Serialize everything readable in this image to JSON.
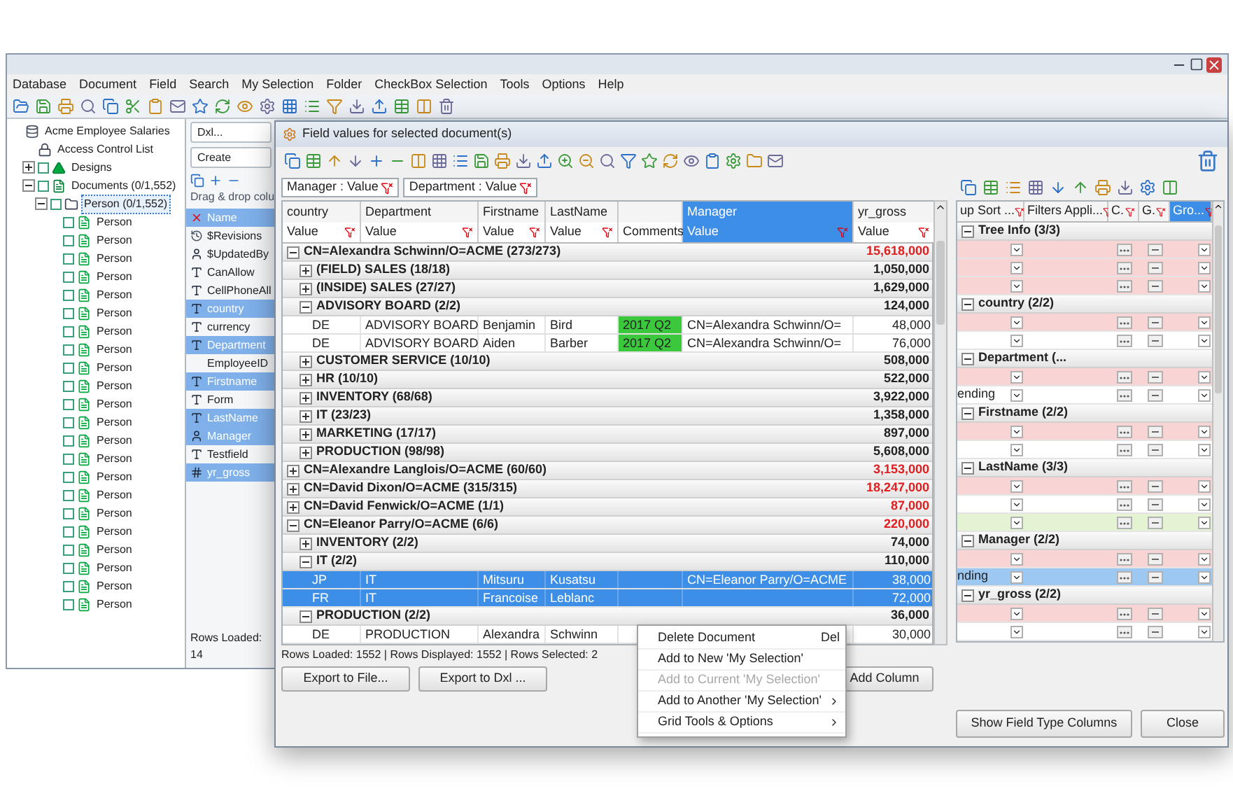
{
  "window": {
    "menu": [
      "Database",
      "Document",
      "Field",
      "Search",
      "My Selection",
      "Folder",
      "CheckBox Selection",
      "Tools",
      "Options",
      "Help"
    ]
  },
  "tree": [
    {
      "label": "Acme Employee Salaries",
      "kind": "database",
      "selected": false,
      "children": [
        {
          "label": "Access Control List",
          "kind": "acl",
          "selected": false
        },
        {
          "label": "Designs",
          "kind": "design",
          "expanded": false,
          "checked": false,
          "selected": false
        },
        {
          "label": "Documents (0/1,552)",
          "kind": "documents",
          "expanded": true,
          "checked": false,
          "selected": false,
          "children": [
            {
              "label": "Person (0/1,552)",
              "kind": "folder",
              "expanded": true,
              "checked": false,
              "selected": true,
              "children": [
                {
                  "label": "Person",
                  "kind": "document",
                  "checked": false,
                  "selected": false
                },
                {
                  "label": "Person",
                  "kind": "document",
                  "checked": false,
                  "selected": false
                },
                {
                  "label": "Person",
                  "kind": "document",
                  "checked": false,
                  "selected": false
                },
                {
                  "label": "Person",
                  "kind": "document",
                  "checked": false,
                  "selected": false
                },
                {
                  "label": "Person",
                  "kind": "document",
                  "checked": false,
                  "selected": false
                },
                {
                  "label": "Person",
                  "kind": "document",
                  "checked": false,
                  "selected": false
                },
                {
                  "label": "Person",
                  "kind": "document",
                  "checked": false,
                  "selected": false
                },
                {
                  "label": "Person",
                  "kind": "document",
                  "checked": false,
                  "selected": false
                },
                {
                  "label": "Person",
                  "kind": "document",
                  "checked": false,
                  "selected": false
                },
                {
                  "label": "Person",
                  "kind": "document",
                  "checked": false,
                  "selected": false
                },
                {
                  "label": "Person",
                  "kind": "document",
                  "checked": false,
                  "selected": false
                },
                {
                  "label": "Person",
                  "kind": "document",
                  "checked": false,
                  "selected": false
                },
                {
                  "label": "Person",
                  "kind": "document",
                  "checked": false,
                  "selected": false
                },
                {
                  "label": "Person",
                  "kind": "document",
                  "checked": false,
                  "selected": false
                },
                {
                  "label": "Person",
                  "kind": "document",
                  "checked": false,
                  "selected": false
                },
                {
                  "label": "Person",
                  "kind": "document",
                  "checked": false,
                  "selected": false
                },
                {
                  "label": "Person",
                  "kind": "document",
                  "checked": false,
                  "selected": false
                },
                {
                  "label": "Person",
                  "kind": "document",
                  "checked": false,
                  "selected": false
                },
                {
                  "label": "Person",
                  "kind": "document",
                  "checked": false,
                  "selected": false
                },
                {
                  "label": "Person",
                  "kind": "document",
                  "checked": false,
                  "selected": false
                },
                {
                  "label": "Person",
                  "kind": "document",
                  "checked": false,
                  "selected": false
                },
                {
                  "label": "Person",
                  "kind": "document",
                  "checked": false,
                  "selected": false
                }
              ]
            }
          ]
        }
      ]
    }
  ],
  "field_panel": {
    "buttons": [
      "Dxl...",
      "Create"
    ],
    "hint": "Drag & drop colu",
    "status": "Rows Loaded: 14",
    "fields": [
      {
        "label": "Name",
        "kind": "name",
        "selected": true
      },
      {
        "label": "$Revisions",
        "kind": "revisions",
        "selected": false
      },
      {
        "label": "$UpdatedBy",
        "kind": "names",
        "selected": false
      },
      {
        "label": "CanAllow",
        "kind": "text",
        "selected": false
      },
      {
        "label": "CellPhoneAll",
        "kind": "text",
        "selected": false
      },
      {
        "label": "country",
        "kind": "text",
        "selected": true
      },
      {
        "label": "currency",
        "kind": "text",
        "selected": false
      },
      {
        "label": "Department",
        "kind": "text",
        "selected": true
      },
      {
        "label": "EmployeeID",
        "kind": "plain",
        "selected": false
      },
      {
        "label": "Firstname",
        "kind": "text",
        "selected": true
      },
      {
        "label": "Form",
        "kind": "text",
        "selected": false
      },
      {
        "label": "LastName",
        "kind": "text",
        "selected": true
      },
      {
        "label": "Manager",
        "kind": "names",
        "selected": true
      },
      {
        "label": "Testfield",
        "kind": "text",
        "selected": false
      },
      {
        "label": "yr_gross",
        "kind": "number",
        "selected": true
      }
    ]
  },
  "dialog": {
    "title": "Field values for selected document(s)",
    "filters": [
      "Manager : Value",
      "Department : Value"
    ],
    "columns": [
      {
        "label": "country",
        "filter": "Value",
        "selected": false
      },
      {
        "label": "Department",
        "filter": "Value",
        "selected": false
      },
      {
        "label": "Firstname",
        "filter": "Value",
        "selected": false
      },
      {
        "label": "LastName",
        "filter": "Value",
        "selected": false
      },
      {
        "filter": "Comments",
        "selected": false
      },
      {
        "label": "Manager",
        "filter": "Value",
        "selected": true
      },
      {
        "label": "yr_gross",
        "filter": "Value",
        "selected": false
      }
    ],
    "rows": [
      {
        "kind": "group",
        "label": "CN=Alexandra Schwinn/O=ACME (273/273)",
        "value": "15,618,000",
        "expanded": true,
        "children": [
          {
            "kind": "group",
            "label": "(FIELD) SALES (18/18)",
            "value": "1,050,000",
            "expanded": false
          },
          {
            "kind": "group",
            "label": "(INSIDE) SALES (27/27)",
            "value": "1,629,000",
            "expanded": false
          },
          {
            "kind": "group",
            "label": "ADVISORY BOARD (2/2)",
            "value": "124,000",
            "expanded": true,
            "children": [
              {
                "kind": "record",
                "selected": false,
                "color": "#3cc83c",
                "country": "DE",
                "department": "ADVISORY BOARD",
                "firstname": "Benjamin",
                "lastname": "Bird",
                "comments": "2017 Q2",
                "manager": "CN=Alexandra Schwinn/O=",
                "yr_gross": "48,000"
              },
              {
                "kind": "record",
                "selected": false,
                "color": "#3cc83c",
                "country": "DE",
                "department": "ADVISORY BOARD",
                "firstname": "Aiden",
                "lastname": "Barber",
                "comments": "2017 Q2",
                "manager": "CN=Alexandra Schwinn/O=",
                "yr_gross": "76,000"
              }
            ]
          },
          {
            "kind": "group",
            "label": "CUSTOMER SERVICE (10/10)",
            "value": "508,000",
            "expanded": false
          },
          {
            "kind": "group",
            "label": "HR (10/10)",
            "value": "522,000",
            "expanded": false
          },
          {
            "kind": "group",
            "label": "INVENTORY (68/68)",
            "value": "3,922,000",
            "expanded": false
          },
          {
            "kind": "group",
            "label": "IT (23/23)",
            "value": "1,358,000",
            "expanded": false
          },
          {
            "kind": "group",
            "label": "MARKETING (17/17)",
            "value": "897,000",
            "expanded": false
          },
          {
            "kind": "group",
            "label": "PRODUCTION (98/98)",
            "value": "5,608,000",
            "expanded": false
          }
        ]
      },
      {
        "kind": "group",
        "label": "CN=Alexandre Langlois/O=ACME (60/60)",
        "value": "3,153,000",
        "expanded": false
      },
      {
        "kind": "group",
        "label": "CN=David Dixon/O=ACME (315/315)",
        "value": "18,247,000",
        "expanded": false
      },
      {
        "kind": "group",
        "label": "CN=David Fenwick/O=ACME (1/1)",
        "value": "87,000",
        "expanded": false
      },
      {
        "kind": "group",
        "label": "CN=Eleanor Parry/O=ACME (6/6)",
        "value": "220,000",
        "expanded": true,
        "children": [
          {
            "kind": "group",
            "label": "INVENTORY (2/2)",
            "value": "74,000",
            "expanded": false
          },
          {
            "kind": "group",
            "label": "IT (2/2)",
            "value": "110,000",
            "expanded": true,
            "children": [
              {
                "kind": "record",
                "selected": true,
                "country": "JP",
                "department": "IT",
                "firstname": "Mitsuru",
                "lastname": "Kusatsu",
                "manager": "CN=Eleanor Parry/O=ACME",
                "yr_gross": "38,000"
              },
              {
                "kind": "record",
                "selected": true,
                "country": "FR",
                "department": "IT",
                "firstname": "Francoise",
                "lastname": "Leblanc",
                "yr_gross": "72,000"
              }
            ]
          },
          {
            "kind": "group",
            "label": "PRODUCTION (2/2)",
            "value": "36,000",
            "expanded": true,
            "children": [
              {
                "kind": "record",
                "selected": false,
                "country": "DE",
                "department": "PRODUCTION",
                "firstname": "Alexandra",
                "lastname": "Schwinn",
                "yr_gross": "30,000"
              }
            ]
          }
        ]
      }
    ],
    "status": "Rows Loaded: 1552 | Rows Displayed: 1552 | Rows Selected: 2",
    "buttons": [
      "Export to File...",
      "Export to Dxl ...",
      "Add Column"
    ]
  },
  "properties": {
    "columns": [
      {
        "label": "up Sort ...",
        "selected": false
      },
      {
        "label": "Filters Appli...",
        "selected": false
      },
      {
        "label": "C.",
        "selected": false
      },
      {
        "label": "G.",
        "selected": false
      },
      {
        "label": "Gro...",
        "selected": true
      }
    ],
    "groups": [
      {
        "label": "Tree Info (3/3)",
        "expanded": true,
        "rows": [
          {
            "color": "#f8d4d4"
          },
          {
            "color": "#f8d4d4"
          },
          {
            "color": "#f8d4d4"
          }
        ]
      },
      {
        "label": "country (2/2)",
        "expanded": true,
        "rows": [
          {
            "color": "#f8d4d4"
          },
          {
            "color": "#ffffff"
          }
        ]
      },
      {
        "label": "Department (...",
        "expanded": true,
        "rows": [
          {
            "color": "#f8d4d4"
          },
          {
            "color": "#ffffff",
            "text": "ending"
          }
        ]
      },
      {
        "label": "Firstname (2/2)",
        "expanded": true,
        "rows": [
          {
            "color": "#f8d4d4"
          },
          {
            "color": "#ffffff"
          }
        ]
      },
      {
        "label": "LastName (3/3)",
        "expanded": true,
        "rows": [
          {
            "color": "#f8d4d4"
          },
          {
            "color": "#ffffff"
          },
          {
            "color": "#e4f4d2"
          }
        ]
      },
      {
        "label": "Manager (2/2)",
        "expanded": true,
        "rows": [
          {
            "color": "#f8d4d4"
          },
          {
            "color": "#9cc8f2",
            "text": "nding"
          }
        ]
      },
      {
        "label": "yr_gross (2/2)",
        "expanded": true,
        "rows": [
          {
            "color": "#f8d4d4"
          },
          {
            "color": "#ffffff"
          }
        ]
      }
    ],
    "buttons": [
      "Show Field Type Columns",
      "Close"
    ]
  },
  "context_menu": {
    "items": [
      {
        "label": "Delete Document",
        "shortcut": "Del",
        "disabled": false,
        "submenu": false
      },
      {
        "label": "Add to New 'My Selection'",
        "disabled": false,
        "submenu": false
      },
      {
        "label": "Add to Current 'My Selection'",
        "disabled": true,
        "submenu": false
      },
      {
        "label": "Add to Another 'My Selection'",
        "disabled": false,
        "submenu": true
      },
      {
        "label": "Grid Tools & Options",
        "disabled": false,
        "submenu": true
      }
    ]
  }
}
